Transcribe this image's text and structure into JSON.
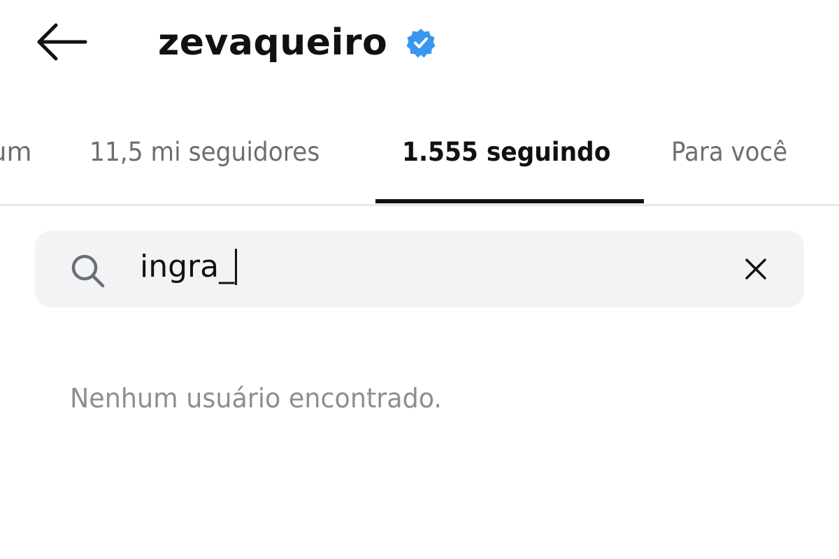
{
  "header": {
    "back_icon": "arrow-left-icon",
    "username": "zevaqueiro",
    "verified_icon": "verified-badge-icon",
    "verified_color": "#3897f0"
  },
  "tabs": [
    {
      "label": "um",
      "active": false
    },
    {
      "label": "11,5 mi seguidores",
      "active": false
    },
    {
      "label": "1.555 seguindo",
      "active": true
    },
    {
      "label": "Para você",
      "active": false
    }
  ],
  "search": {
    "icon": "search-icon",
    "value": "ingra_",
    "clear_icon": "close-icon"
  },
  "results": {
    "empty_message": "Nenhum usuário encontrado."
  },
  "colors": {
    "background": "#ffffff",
    "text_primary": "#111111",
    "text_secondary": "#6b6e72",
    "search_bg": "#f2f3f5",
    "divider": "#e6e7ea",
    "accent": "#3897f0"
  }
}
